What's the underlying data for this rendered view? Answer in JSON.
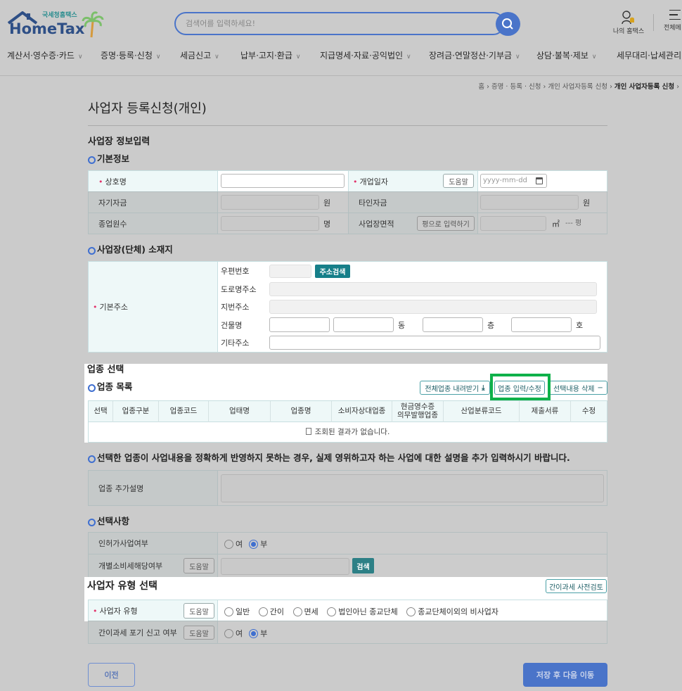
{
  "header": {
    "logo_small": "국세청홈택스",
    "logo_main": "HomeTax",
    "search_placeholder": "검색어를 입력하세요!",
    "my_hometax": "나의 홈택스",
    "all_menu": "전체메"
  },
  "nav": [
    "계산서·영수증·카드",
    "증명·등록·신청",
    "세금신고",
    "납부·고지·환급",
    "지급명세·자료·공익법인",
    "장려금·연말정산·기부금",
    "상담·불복·제보",
    "세무대리·납세관리"
  ],
  "breadcrumb": [
    "홈",
    "증명 · 등록 · 신청",
    "개인 사업자등록 신청",
    "개인 사업자등록 신청"
  ],
  "page_title": "사업자 등록신청(개인)",
  "section_info": "사업장 정보입력",
  "basic": {
    "title": "기본정보",
    "trade_name": "상호명",
    "open_date": "개업일자",
    "help": "도움말",
    "date_placeholder": "yyyy-mm-dd",
    "own_capital": "자기자금",
    "other_capital": "타인자금",
    "won": "원",
    "employees": "종업원수",
    "people": "명",
    "area": "사업장면적",
    "pyeong_input": "평으로 입력하기",
    "sqm": "㎡",
    "pyeong": "--- 평"
  },
  "address": {
    "title": "사업장(단체) 소재지",
    "label": "기본주소",
    "zip": "우편번호",
    "search": "주소검색",
    "road": "도로명주소",
    "lot": "지번주소",
    "building": "건물명",
    "dong": "동",
    "floor": "층",
    "ho": "호",
    "etc": "기타주소"
  },
  "industry": {
    "title": "업종 선택",
    "list_title": "업종 목록",
    "btn_download": "전체업종 내려받기",
    "btn_edit": "업종 입력/수정",
    "btn_delete": "선택내용 삭제",
    "columns": [
      "선택",
      "업종구분",
      "업종코드",
      "업태명",
      "업종명",
      "소비자상대업종",
      "현금영수증\n의무발행업종",
      "산업분류코드",
      "제출서류",
      "수정"
    ],
    "empty": "조회된 결과가 없습니다."
  },
  "note": "선택한 업종이 사업내용을 정확하게 반영하지 못하는 경우, 실제 영위하고자 하는 사업에 대한 설명을 추가 입력하시기 바랍니다.",
  "extra_desc_label": "업종 추가설명",
  "options": {
    "title": "선택사항",
    "license": "인허가사업여부",
    "yes": "여",
    "no": "부",
    "excise": "개별소비세해당여부",
    "help": "도움말",
    "search": "검색"
  },
  "biz_type": {
    "title": "사업자 유형 선택",
    "precheck": "간이과세 사전검토",
    "label": "사업자 유형",
    "help": "도움말",
    "choices": [
      "일반",
      "간이",
      "면세",
      "법인아닌 종교단체",
      "종교단체이외의 비사업자"
    ],
    "waiver": "간이과세 포기 신고 여부",
    "yes": "여",
    "no": "부"
  },
  "footer": {
    "prev": "이전",
    "next": "저장 후 다음 이동"
  },
  "colors": {
    "highlight": "#0fb14a",
    "teal": "#167f89",
    "primary": "#4a74c9"
  }
}
